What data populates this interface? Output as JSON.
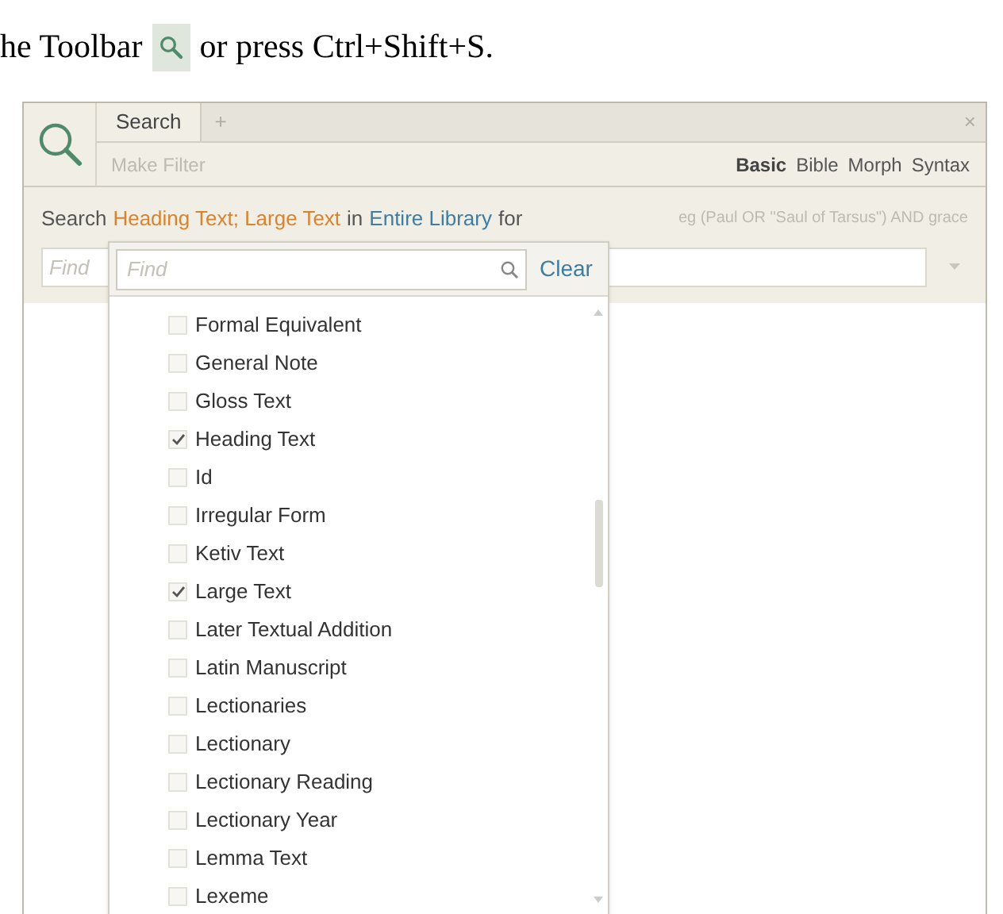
{
  "doc_text": {
    "before": "he Toolbar",
    "after": "or press Ctrl+Shift+S."
  },
  "search_panel": {
    "tabs": [
      {
        "label": "Search",
        "selected": true
      }
    ],
    "add_tab": "+",
    "close": "×",
    "make_filter": "Make Filter",
    "modes": [
      {
        "label": "Basic",
        "selected": true
      },
      {
        "label": "Bible",
        "selected": false
      },
      {
        "label": "Morph",
        "selected": false
      },
      {
        "label": "Syntax",
        "selected": false
      }
    ],
    "query": [
      {
        "kind": "plain",
        "text": "Search"
      },
      {
        "kind": "field",
        "text": "Heading Text; Large Text"
      },
      {
        "kind": "plain",
        "text": "in"
      },
      {
        "kind": "library",
        "text": "Entire Library"
      },
      {
        "kind": "plain",
        "text": "for"
      }
    ],
    "hint": "eg (Paul OR \"Saul of Tarsus\") AND grace",
    "find_placeholder": "Find"
  },
  "field_dropdown": {
    "filter_placeholder": "Find",
    "clear": "Clear",
    "items": [
      {
        "label": "Formal Equivalent",
        "checked": false
      },
      {
        "label": "General Note",
        "checked": false
      },
      {
        "label": "Gloss Text",
        "checked": false
      },
      {
        "label": "Heading Text",
        "checked": true
      },
      {
        "label": "Id",
        "checked": false
      },
      {
        "label": "Irregular Form",
        "checked": false
      },
      {
        "label": "Ketiv Text",
        "checked": false
      },
      {
        "label": "Large Text",
        "checked": true
      },
      {
        "label": "Later Textual Addition",
        "checked": false
      },
      {
        "label": "Latin Manuscript",
        "checked": false
      },
      {
        "label": "Lectionaries",
        "checked": false
      },
      {
        "label": "Lectionary",
        "checked": false
      },
      {
        "label": "Lectionary Reading",
        "checked": false
      },
      {
        "label": "Lectionary Year",
        "checked": false
      },
      {
        "label": "Lemma Text",
        "checked": false
      },
      {
        "label": "Lexeme",
        "checked": false
      }
    ]
  }
}
